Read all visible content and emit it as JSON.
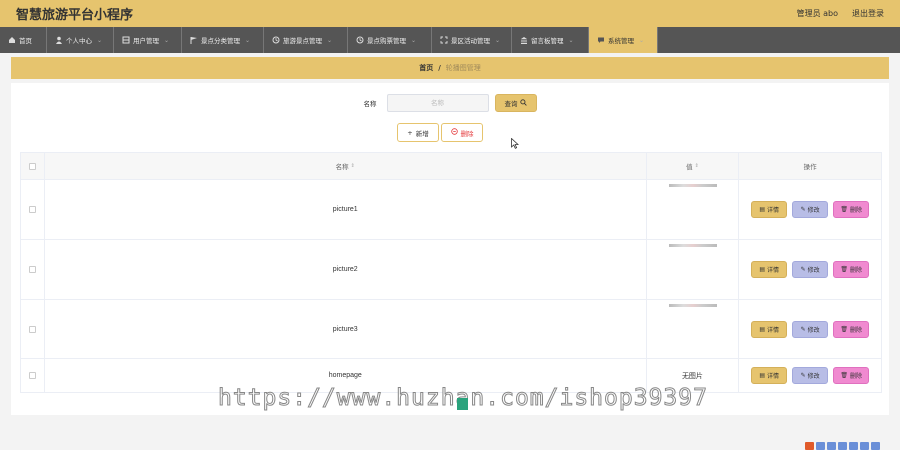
{
  "app": {
    "title": "智慧旅游平台小程序",
    "user_label": "管理员 abo",
    "logout_label": "退出登录"
  },
  "nav": [
    {
      "label": "首页",
      "icon": "home-icon",
      "active": false
    },
    {
      "label": "个人中心",
      "icon": "user-icon",
      "active": false
    },
    {
      "label": "用户管理",
      "icon": "grid-icon",
      "active": false
    },
    {
      "label": "景点分类管理",
      "icon": "flag-icon",
      "active": false
    },
    {
      "label": "旅游景点管理",
      "icon": "clock-icon",
      "active": false
    },
    {
      "label": "景点购票管理",
      "icon": "clock-icon",
      "active": false
    },
    {
      "label": "景区活动管理",
      "icon": "expand-icon",
      "active": false
    },
    {
      "label": "留言板管理",
      "icon": "bank-icon",
      "active": false
    },
    {
      "label": "系统管理",
      "icon": "message-icon",
      "active": true
    }
  ],
  "breadcrumb": {
    "home": "首页",
    "separator": "/",
    "current": "轮播图管理"
  },
  "search": {
    "label": "名称",
    "placeholder": "名称",
    "button": "查询"
  },
  "actions": {
    "add": "新增",
    "delete": "删除"
  },
  "table": {
    "headers": {
      "name": "名称",
      "value": "值",
      "ops": "操作"
    },
    "rows": [
      {
        "name": "picture1",
        "value": "",
        "has_image": true
      },
      {
        "name": "picture2",
        "value": "",
        "has_image": true
      },
      {
        "name": "picture3",
        "value": "",
        "has_image": true
      },
      {
        "name": "homepage",
        "value": "无图片",
        "has_image": false
      }
    ],
    "row_ops": {
      "detail": "详情",
      "edit": "修改",
      "delete": "删除"
    }
  },
  "watermark": "https://www.huzhan.com/ishop39397",
  "colors": {
    "accent": "#e6c46e",
    "nav_bg": "#555555",
    "edit": "#b8bde6",
    "delete": "#f08ad0"
  }
}
